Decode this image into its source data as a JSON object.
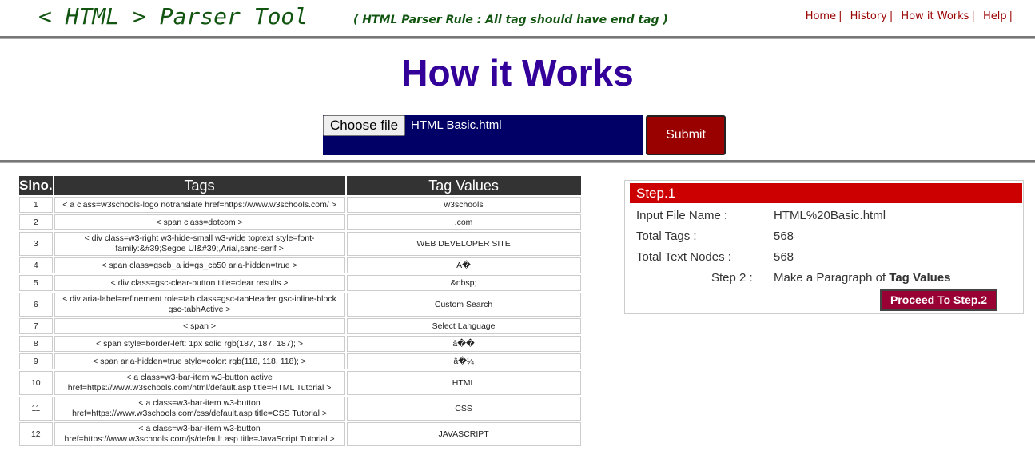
{
  "header": {
    "logo": "< HTML > Parser Tool",
    "rule_note": "( HTML Parser Rule : All tag should have end tag )",
    "nav": [
      {
        "label": "Home"
      },
      {
        "label": "History"
      },
      {
        "label": "How it Works"
      },
      {
        "label": "Help"
      }
    ],
    "nav_separator": "|"
  },
  "main": {
    "title": "How it Works",
    "choose_file_label": "Choose file",
    "file_name": "HTML Basic.html",
    "submit_label": "Submit"
  },
  "table": {
    "headers": [
      "Slno.",
      "Tags",
      "Tag Values"
    ],
    "rows": [
      {
        "no": "1",
        "tag": "< a class=w3schools-logo notranslate href=https://www.w3schools.com/ >",
        "value": "w3schools"
      },
      {
        "no": "2",
        "tag": "< span class=dotcom >",
        "value": ".com"
      },
      {
        "no": "3",
        "tag": "< div class=w3-right w3-hide-small w3-wide toptext style=font-family:&#39;Segoe UI&#39;,Arial,sans-serif >",
        "value": "WEB DEVELOPER SITE"
      },
      {
        "no": "4",
        "tag": "< span class=gscb_a id=gs_cb50 aria-hidden=true >",
        "value": "Ã�"
      },
      {
        "no": "5",
        "tag": "< div class=gsc-clear-button title=clear results >",
        "value": "&nbsp;"
      },
      {
        "no": "6",
        "tag": "< div aria-label=refinement role=tab class=gsc-tabHeader gsc-inline-block gsc-tabhActive >",
        "value": "Custom Search"
      },
      {
        "no": "7",
        "tag": "< span >",
        "value": "Select Language"
      },
      {
        "no": "8",
        "tag": "< span style=border-left: 1px solid rgb(187, 187, 187); >",
        "value": "â��"
      },
      {
        "no": "9",
        "tag": "< span aria-hidden=true style=color: rgb(118, 118, 118); >",
        "value": "â�¼"
      },
      {
        "no": "10",
        "tag": "< a class=w3-bar-item w3-button active href=https://www.w3schools.com/html/default.asp title=HTML Tutorial >",
        "value": "HTML"
      },
      {
        "no": "11",
        "tag": "< a class=w3-bar-item w3-button href=https://www.w3schools.com/css/default.asp title=CSS Tutorial >",
        "value": "CSS"
      },
      {
        "no": "12",
        "tag": "< a class=w3-bar-item w3-button href=https://www.w3schools.com/js/default.asp title=JavaScript Tutorial >",
        "value": "JAVASCRIPT"
      }
    ]
  },
  "step_panel": {
    "heading": "Step.1",
    "input_file_label": "Input File Name :",
    "input_file_value": "HTML%20Basic.html",
    "total_tags_label": "Total Tags :",
    "total_tags_value": "568",
    "total_text_label": "Total Text Nodes :",
    "total_text_value": "568",
    "step2_label": "Step 2 :",
    "step2_text": "Make a Paragraph of ",
    "step2_bold": "Tag Values",
    "proceed_label": "Proceed To Step.2"
  }
}
